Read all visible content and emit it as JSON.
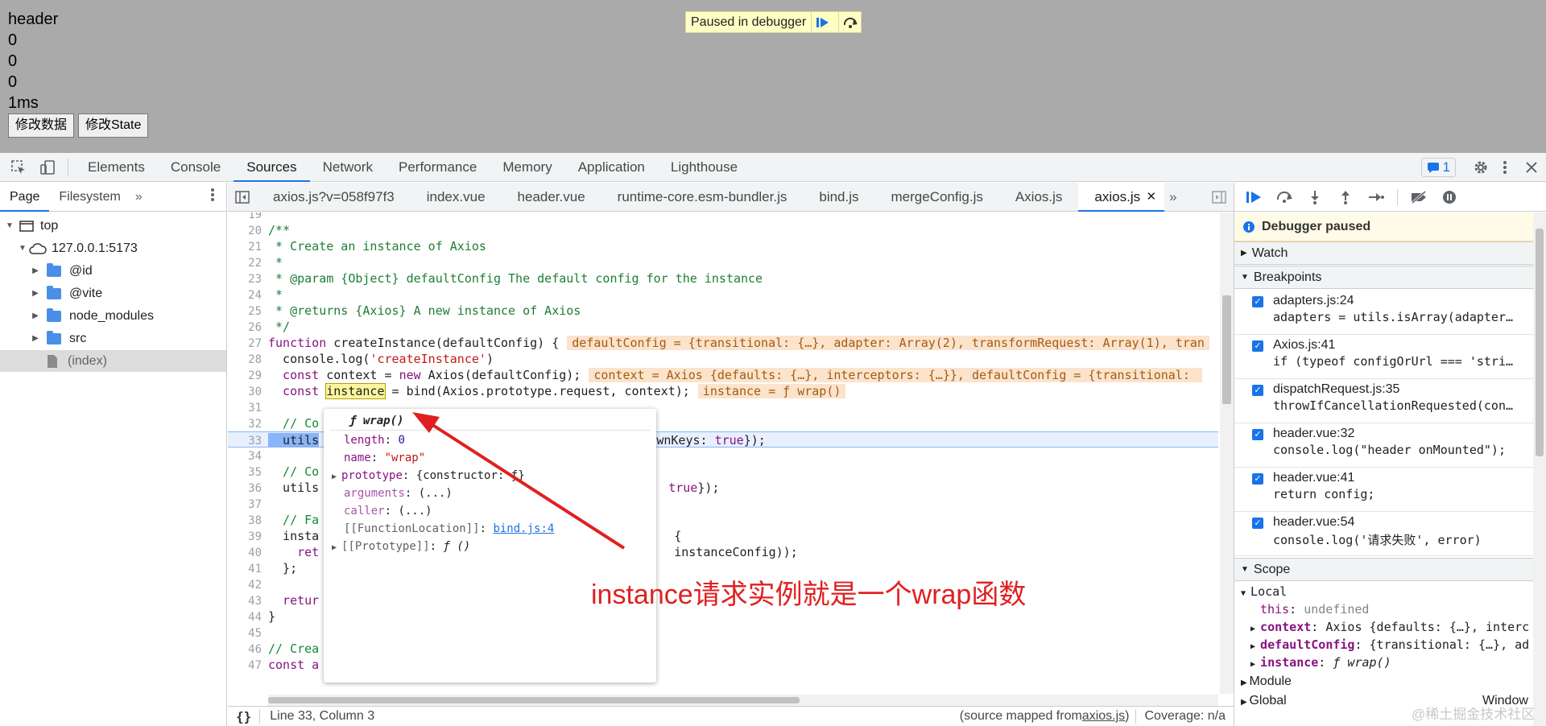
{
  "page": {
    "lines": [
      "header",
      "0",
      "0",
      "0",
      "1ms"
    ],
    "buttons": [
      "修改数据",
      "修改State"
    ],
    "paused_banner": "Paused in debugger"
  },
  "devtools": {
    "tabs": [
      "Elements",
      "Console",
      "Sources",
      "Network",
      "Performance",
      "Memory",
      "Application",
      "Lighthouse"
    ],
    "active_tab": "Sources",
    "issues_count": "1"
  },
  "navigator": {
    "tabs": [
      "Page",
      "Filesystem"
    ],
    "tree": [
      {
        "label": "top"
      },
      {
        "label": "127.0.0.1:5173"
      },
      {
        "label": "@id"
      },
      {
        "label": "@vite"
      },
      {
        "label": "node_modules"
      },
      {
        "label": "src"
      },
      {
        "label": "(index)"
      }
    ]
  },
  "editor": {
    "file_tabs": [
      "axios.js?v=058f97f3",
      "index.vue",
      "header.vue",
      "runtime-core.esm-bundler.js",
      "bind.js",
      "mergeConfig.js",
      "Axios.js",
      "axios.js"
    ],
    "active_file": "axios.js",
    "code": {
      "l19": "19",
      "l20": "20",
      "c20": "/**",
      "l21": "21",
      "c21": " * Create an instance of Axios",
      "l22": "22",
      "c22": " *",
      "l23": "23",
      "c23": " * @param {Object} defaultConfig The default config for the instance",
      "l24": "24",
      "c24": " *",
      "l25": "25",
      "c25": " * @returns {Axios} A new instance of Axios",
      "l26": "26",
      "c26": " */",
      "l27": "27",
      "c27a": "function",
      "c27b": " createInstance(defaultConfig) {",
      "i27": "defaultConfig = {transitional: {…}, adapter: Array(2), transformRequest: Array(1), tran",
      "l28": "28",
      "c28a": "  console.log(",
      "c28b": "'createInstance'",
      "c28c": ")",
      "l29": "29",
      "c29a": "  const",
      "c29b": " context = ",
      "c29c": "new",
      "c29d": " Axios(defaultConfig);",
      "i29": "context = Axios {defaults: {…}, interceptors: {…}}, defaultConfig = {transitional: ",
      "l30": "30",
      "c30a": "  const",
      "c30b": " ",
      "c30c": "instance",
      "c30d": " = bind(Axios.prototype.request, context);",
      "i30": "instance = ƒ wrap()",
      "l31": "31",
      "l32": "32",
      "c32": "  // Co",
      "l33": "33",
      "c33a": "  utils",
      "c33b": "allOwnKeys: ",
      "c33c": "true",
      "c33d": "});",
      "l34": "34",
      "l35": "35",
      "c35": "  // Co",
      "l36": "36",
      "c36a": "  utils",
      "c36b": "true",
      "c36c": "});",
      "l37": "37",
      "l38": "38",
      "c38": "  // Fa",
      "l39": "39",
      "c39a": "  insta",
      "c39b": "{",
      "l40": "40",
      "c40a": "    ret",
      "c40b": "instanceConfig));",
      "l41": "41",
      "c41": "  };",
      "l42": "42",
      "l43": "43",
      "c43": "  retur",
      "l44": "44",
      "c44": "}",
      "l45": "45",
      "l46": "46",
      "c46": "// Crea",
      "l47": "47",
      "c47": "const a"
    },
    "status": {
      "position": "Line 33, Column 3",
      "source_prefix": "(source mapped from ",
      "source_link": "axios.js",
      "source_suffix": ")",
      "coverage": "Coverage: n/a"
    }
  },
  "popover": {
    "title": "ƒ wrap()",
    "rows": {
      "length_k": "length",
      "length_v": "0",
      "name_k": "name",
      "name_v": "\"wrap\"",
      "prototype_k": "prototype",
      "prototype_v": "{constructor: ƒ}",
      "arguments_k": "arguments",
      "arguments_v": "(...)",
      "caller_k": "caller",
      "caller_v": "(...)",
      "fl_k": "[[FunctionLocation]]",
      "fl_v": "bind.js:4",
      "proto_k": "[[Prototype]]",
      "proto_v": "ƒ ()"
    }
  },
  "annotation": "instance请求实例就是一个wrap函数",
  "sidebar": {
    "debugger_paused": "Debugger paused",
    "sections": {
      "watch": "Watch",
      "breakpoints": "Breakpoints",
      "scope": "Scope"
    },
    "breakpoints": [
      {
        "file": "adapters.js:24",
        "code": "adapters = utils.isArray(adapter…"
      },
      {
        "file": "Axios.js:41",
        "code": "if (typeof configOrUrl === 'stri…"
      },
      {
        "file": "dispatchRequest.js:35",
        "code": "throwIfCancellationRequested(con…"
      },
      {
        "file": "header.vue:32",
        "code": "console.log(\"header onMounted\");"
      },
      {
        "file": "header.vue:41",
        "code": "return config;"
      },
      {
        "file": "header.vue:54",
        "code": "console.log('请求失败', error)"
      }
    ],
    "scope": {
      "local": "Local",
      "this_k": "this",
      "this_v": "undefined",
      "context_k": "context",
      "context_v": "Axios {defaults: {…}, interc",
      "dc_k": "defaultConfig",
      "dc_v": "{transitional: {…}, ad",
      "inst_k": "instance",
      "inst_v": "ƒ wrap()",
      "module": "Module",
      "global": "Global",
      "global_v": "Window"
    }
  },
  "watermark": "@稀土掘金技术社区"
}
